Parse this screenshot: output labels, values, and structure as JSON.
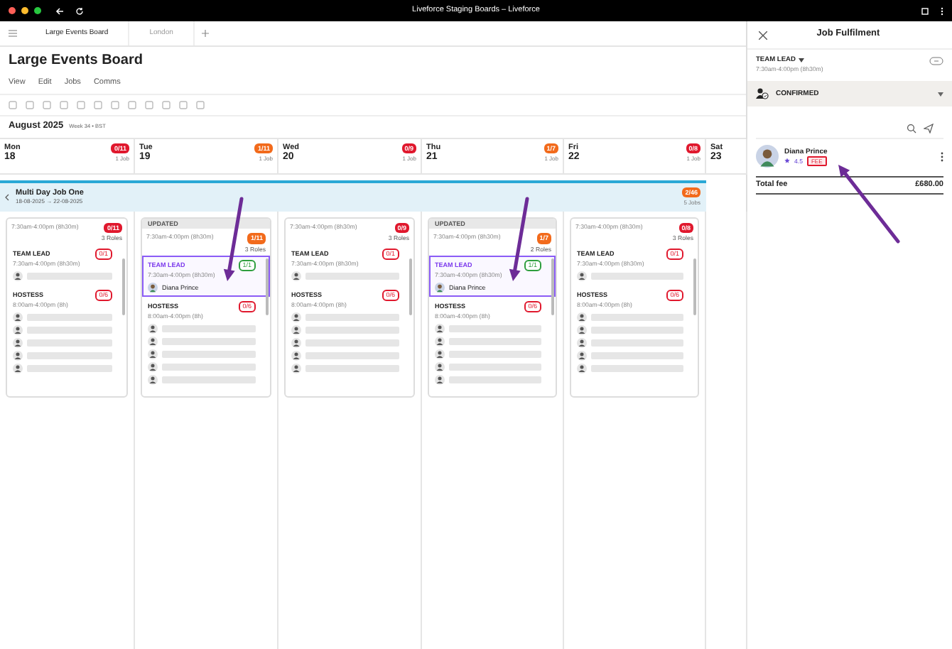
{
  "browser": {
    "title": "Liveforce Staging Boards – Liveforce"
  },
  "tabs": [
    {
      "label": "Large Events Board",
      "selected": true
    },
    {
      "label": "London",
      "selected": false
    }
  ],
  "title": "Large Events Board",
  "menu": [
    "View",
    "Edit",
    "Jobs",
    "Comms"
  ],
  "month": {
    "label": "August 2025",
    "week": "Week 34 • BST"
  },
  "days": [
    {
      "name": "Mon",
      "date": "18",
      "badge": {
        "text": "0/11",
        "color": "#e0182d"
      },
      "jobs": "1 Job"
    },
    {
      "name": "Tue",
      "date": "19",
      "badge": {
        "text": "1/11",
        "color": "#f26a1b"
      },
      "jobs": "1 Job"
    },
    {
      "name": "Wed",
      "date": "20",
      "badge": {
        "text": "0/9",
        "color": "#e0182d"
      },
      "jobs": "1 Job"
    },
    {
      "name": "Thu",
      "date": "21",
      "badge": {
        "text": "1/7",
        "color": "#f26a1b"
      },
      "jobs": "1 Job"
    },
    {
      "name": "Fri",
      "date": "22",
      "badge": {
        "text": "0/8",
        "color": "#e0182d"
      },
      "jobs": "1 Job"
    },
    {
      "name": "Sat",
      "date": "23"
    }
  ],
  "multi_day_job": {
    "title": "Multi Day Job One",
    "badge": {
      "text": "2/46",
      "color": "#f26a1b"
    },
    "dates": "18-08-2025 → 22-08-2025",
    "jobs": "5 Jobs"
  },
  "cards": [
    {
      "updated": false,
      "time": "7:30am-4:00pm (8h30m)",
      "badge": {
        "text": "0/11",
        "color": "#e0182d"
      },
      "roles_count": "3 Roles",
      "roles": [
        {
          "name": "TEAM LEAD",
          "time": "7:30am-4:00pm (8h30m)",
          "badge": {
            "text": "0/1",
            "color": "#e0182d"
          },
          "selected": false,
          "slots": [
            {
              "kind": "open"
            }
          ]
        },
        {
          "name": "HOSTESS",
          "time": "8:00am-4:00pm (8h)",
          "badge": {
            "text": "0/6",
            "color": "#e0182d"
          },
          "selected": false,
          "slots": [
            {
              "kind": "open"
            },
            {
              "kind": "open"
            },
            {
              "kind": "open"
            },
            {
              "kind": "open"
            },
            {
              "kind": "open"
            }
          ]
        }
      ]
    },
    {
      "updated": true,
      "label": "UPDATED",
      "time": "7:30am-4:00pm (8h30m)",
      "badge": {
        "text": "1/11",
        "color": "#f26a1b"
      },
      "roles_count": "3 Roles",
      "roles": [
        {
          "name": "TEAM LEAD",
          "time": "7:30am-4:00pm (8h30m)",
          "badge": {
            "text": "1/1",
            "color": "#2e9e3e"
          },
          "selected": true,
          "slots": [
            {
              "kind": "assigned",
              "name": "Diana Prince"
            }
          ]
        },
        {
          "name": "HOSTESS",
          "time": "8:00am-4:00pm (8h)",
          "badge": {
            "text": "0/6",
            "color": "#e0182d"
          },
          "selected": false,
          "slots": [
            {
              "kind": "open"
            },
            {
              "kind": "open"
            },
            {
              "kind": "open"
            },
            {
              "kind": "open"
            },
            {
              "kind": "open"
            }
          ]
        }
      ]
    },
    {
      "updated": false,
      "time": "7:30am-4:00pm (8h30m)",
      "badge": {
        "text": "0/9",
        "color": "#e0182d"
      },
      "roles_count": "3 Roles",
      "roles": [
        {
          "name": "TEAM LEAD",
          "time": "7:30am-4:00pm (8h30m)",
          "badge": {
            "text": "0/1",
            "color": "#e0182d"
          },
          "selected": false,
          "slots": [
            {
              "kind": "open"
            }
          ]
        },
        {
          "name": "HOSTESS",
          "time": "8:00am-4:00pm (8h)",
          "badge": {
            "text": "0/6",
            "color": "#e0182d"
          },
          "selected": false,
          "slots": [
            {
              "kind": "open"
            },
            {
              "kind": "open"
            },
            {
              "kind": "open"
            },
            {
              "kind": "open"
            },
            {
              "kind": "open"
            }
          ]
        }
      ]
    },
    {
      "updated": true,
      "label": "UPDATED",
      "time": "7:30am-4:00pm (8h30m)",
      "badge": {
        "text": "1/7",
        "color": "#f26a1b"
      },
      "roles_count": "2 Roles",
      "roles": [
        {
          "name": "TEAM LEAD",
          "time": "7:30am-4:00pm (8h30m)",
          "badge": {
            "text": "1/1",
            "color": "#2e9e3e"
          },
          "selected": true,
          "slots": [
            {
              "kind": "assigned",
              "name": "Diana Prince"
            }
          ]
        },
        {
          "name": "HOSTESS",
          "time": "8:00am-4:00pm (8h)",
          "badge": {
            "text": "0/6",
            "color": "#e0182d"
          },
          "selected": false,
          "slots": [
            {
              "kind": "open"
            },
            {
              "kind": "open"
            },
            {
              "kind": "open"
            },
            {
              "kind": "open"
            },
            {
              "kind": "open"
            }
          ]
        }
      ]
    },
    {
      "updated": false,
      "time": "7:30am-4:00pm (8h30m)",
      "badge": {
        "text": "0/8",
        "color": "#e0182d"
      },
      "roles_count": "3 Roles",
      "roles": [
        {
          "name": "TEAM LEAD",
          "time": "7:30am-4:00pm (8h30m)",
          "badge": {
            "text": "0/1",
            "color": "#e0182d"
          },
          "selected": false,
          "slots": [
            {
              "kind": "open"
            }
          ]
        },
        {
          "name": "HOSTESS",
          "time": "8:00am-4:00pm (8h)",
          "badge": {
            "text": "0/6",
            "color": "#e0182d"
          },
          "selected": false,
          "slots": [
            {
              "kind": "open"
            },
            {
              "kind": "open"
            },
            {
              "kind": "open"
            },
            {
              "kind": "open"
            },
            {
              "kind": "open"
            }
          ]
        }
      ]
    }
  ],
  "panel": {
    "title": "Job Fulfilment",
    "role": "TEAM LEAD",
    "time": "7:30am-4:00pm (8h30m)",
    "status": "CONFIRMED",
    "worker": {
      "name": "Diana Prince",
      "rating": "4.5",
      "tag": "FEE"
    },
    "total_label": "Total fee",
    "total": "£680.00"
  }
}
